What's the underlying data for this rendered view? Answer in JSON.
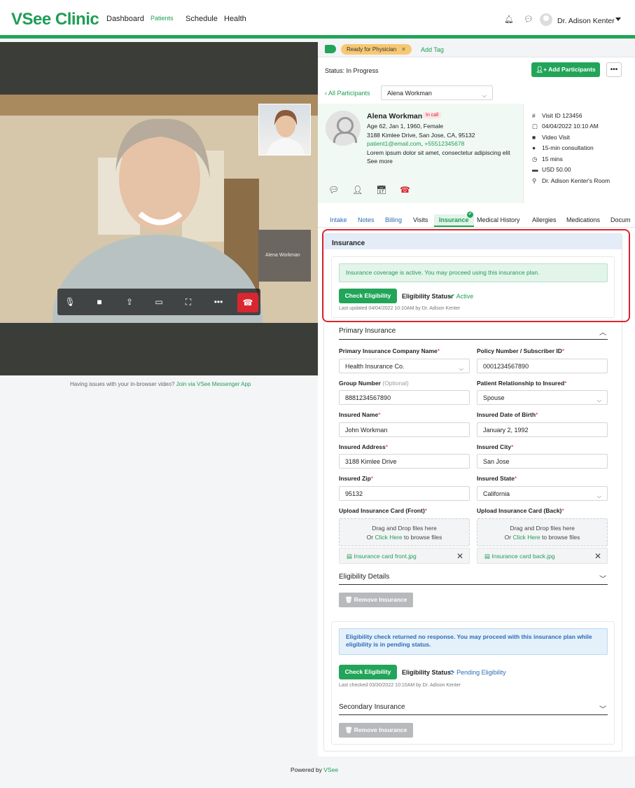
{
  "header": {
    "logo": "VSee Clinic",
    "nav": [
      "Dashboard",
      "Patients",
      "Schedule",
      "Health"
    ],
    "user_name": "Dr. Adison Kenter"
  },
  "video": {
    "remote_thumb_label": "Alena Workman",
    "issue_text": "Having issues with your in-browser video?",
    "issue_link": "Join via VSee Messenger App"
  },
  "tags": {
    "pill": "Ready for Physician",
    "add": "Add Tag"
  },
  "status": {
    "text": "Status: In Progress",
    "add_participants": "Add Participants",
    "more": "•••"
  },
  "participants": {
    "back": "All Participants",
    "selected": "Alena Workman"
  },
  "patient": {
    "name": "Alena Workman",
    "badge": "In call",
    "demographics": "Age 62, Jan 1, 1960, Female",
    "address": "3188 Kimlee Drive, San Jose, CA, 95132",
    "email": "patient1@email.com",
    "phone": "+55512345678",
    "note": "Lorem ipsum dolor sit amet, consectetur adipiscing elit",
    "see_more": "See more"
  },
  "visit": {
    "id": "Visit ID 123456",
    "datetime": "04/04/2022 10:10 AM",
    "type": "Video Visit",
    "reason": "15-min consultation",
    "duration": "15 mins",
    "price": "USD 50.00",
    "room": "Dr. Adison Kenter's Room"
  },
  "tabs": [
    "Intake",
    "Notes",
    "Billing",
    "Visits",
    "Insurance",
    "Medical History",
    "Allergies",
    "Medications",
    "Docum"
  ],
  "insurance": {
    "title": "Insurance",
    "active_alert": "Insurance coverage is active. You may proceed using this insurance plan.",
    "check_label": "Check Eligibility",
    "status_label": "Eligibility Status:",
    "status_active": "Active",
    "last_updated": "Last updated 04/04/2022 10:10AM by Dr. Adison Kenter",
    "primary_title": "Primary Insurance",
    "fields": {
      "company_label": "Primary Insurance Company Name",
      "company_value": "Health Insurance Co.",
      "policy_label": "Policy Number / Subscriber ID",
      "policy_value": "0001234567890",
      "group_label": "Group Number",
      "group_opt": "(Optional)",
      "group_value": "8881234567890",
      "relationship_label": "Patient Relationship to Insured",
      "relationship_value": "Spouse",
      "insured_name_label": "Insured Name",
      "insured_name_value": "John Workman",
      "dob_label": "Insured Date of Birth",
      "dob_value": "January 2, 1992",
      "address_label": "Insured Address",
      "address_value": "3188 Kimlee Drive",
      "city_label": "Insured City",
      "city_value": "San Jose",
      "zip_label": "Insured Zip",
      "zip_value": "95132",
      "state_label": "Insured State",
      "state_value": "California",
      "front_label": "Upload Insurance Card (Front)",
      "back_label": "Upload Insurance Card (Back)",
      "drop_line1": "Drag and Drop files here",
      "drop_or": "Or",
      "drop_link": "Click Here",
      "drop_tail": "to browse files",
      "front_file": "Insurance card front.jpg",
      "back_file": "Insurance card back.jpg"
    },
    "eligibility_details": "Eligibility Details",
    "remove_label": "Remove Insurance",
    "pending_alert": "Eligibility check returned no response. You may proceed with this insurance plan while eligibility is in pending status.",
    "status_pending": "Pending Eligibility",
    "last_checked": "Last checked 03/30/2022 10:10AM by Dr. Adison Kenter",
    "secondary_title": "Secondary Insurance"
  },
  "footer": {
    "prefix": "Powered by",
    "brand": "VSee"
  },
  "colors": {
    "brand": "#22a559",
    "danger": "#d9262f",
    "info": "#2d6cb5"
  }
}
